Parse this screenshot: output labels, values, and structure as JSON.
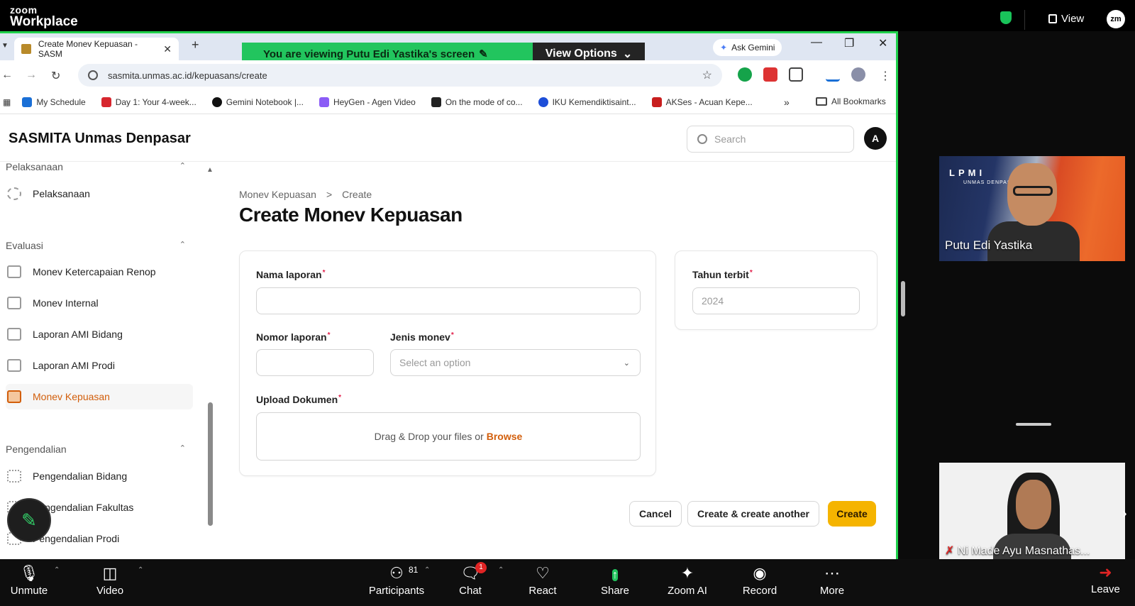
{
  "zoom": {
    "logo_line1": "zoom",
    "logo_line2": "Workplace",
    "view_label": "View",
    "avatar_initials": "zm",
    "viewing_banner": "You are viewing  Putu Edi Yastika's screen",
    "view_options": "View Options"
  },
  "browser": {
    "tab_title": "Create Monev Kepuasan - SASM",
    "url": "sasmita.unmas.ac.id/kepuasans/create",
    "ask_gemini": "Ask Gemini",
    "bookmarks": [
      {
        "label": "My Schedule",
        "color": "#1a6fd6"
      },
      {
        "label": "Day 1: Your 4-week...",
        "color": "#d7262e"
      },
      {
        "label": "Gemini Notebook |...",
        "color": "#111111"
      },
      {
        "label": "HeyGen - Agen Video",
        "color": "#8b5cf6"
      },
      {
        "label": "On the mode of co...",
        "color": "#222222"
      },
      {
        "label": "IKU Kemendiktisaint...",
        "color": "#1d4ed8"
      },
      {
        "label": "AKSes - Acuan Kepe...",
        "color": "#c81e1e"
      }
    ],
    "all_bookmarks": "All Bookmarks"
  },
  "app": {
    "brand": "SASMITA Unmas Denpasar",
    "search_placeholder": "Search",
    "avatar": "A"
  },
  "sidebar": {
    "group_pelaksanaan": "Pelaksanaan",
    "item_pelaksanaan": "Pelaksanaan",
    "group_evaluasi": "Evaluasi",
    "items_evaluasi": [
      "Monev Ketercapaian Renop",
      "Monev Internal",
      "Laporan AMI Bidang",
      "Laporan AMI Prodi",
      "Monev Kepuasan"
    ],
    "group_pengendalian": "Pengendalian",
    "items_pengendalian": [
      "Pengendalian Bidang",
      "Pengendalian Fakultas",
      "Pengendalian Prodi"
    ]
  },
  "page": {
    "breadcrumb_parent": "Monev Kepuasan",
    "breadcrumb_sep": ">",
    "breadcrumb_current": "Create",
    "title": "Create Monev Kepuasan"
  },
  "form": {
    "nama_laporan_label": "Nama laporan",
    "nomor_laporan_label": "Nomor laporan",
    "jenis_monev_label": "Jenis monev",
    "jenis_monev_placeholder": "Select an option",
    "upload_label": "Upload Dokumen",
    "upload_text": "Drag & Drop your files or",
    "upload_browse": "Browse",
    "tahun_terbit_label": "Tahun terbit",
    "tahun_terbit_value": "2024",
    "required_mark": "*"
  },
  "actions": {
    "cancel": "Cancel",
    "create_another": "Create & create another",
    "create": "Create"
  },
  "participants": {
    "video1_name": "Putu Edi Yastika",
    "video1_logo": "LPMI",
    "video1_logo_sub": "UNMAS DENPASAR",
    "video2_name": "Ni Made Ayu Masnathas..."
  },
  "toolbar": {
    "unmute": "Unmute",
    "video": "Video",
    "participants": "Participants",
    "participants_count": "81",
    "chat": "Chat",
    "chat_badge": "1",
    "react": "React",
    "share": "Share",
    "zoom_ai": "Zoom AI",
    "record": "Record",
    "more": "More",
    "leave": "Leave"
  },
  "colors": {
    "zoom_green": "#22c55e",
    "accent_orange": "#d25e0b",
    "create_button": "#f5b400"
  }
}
